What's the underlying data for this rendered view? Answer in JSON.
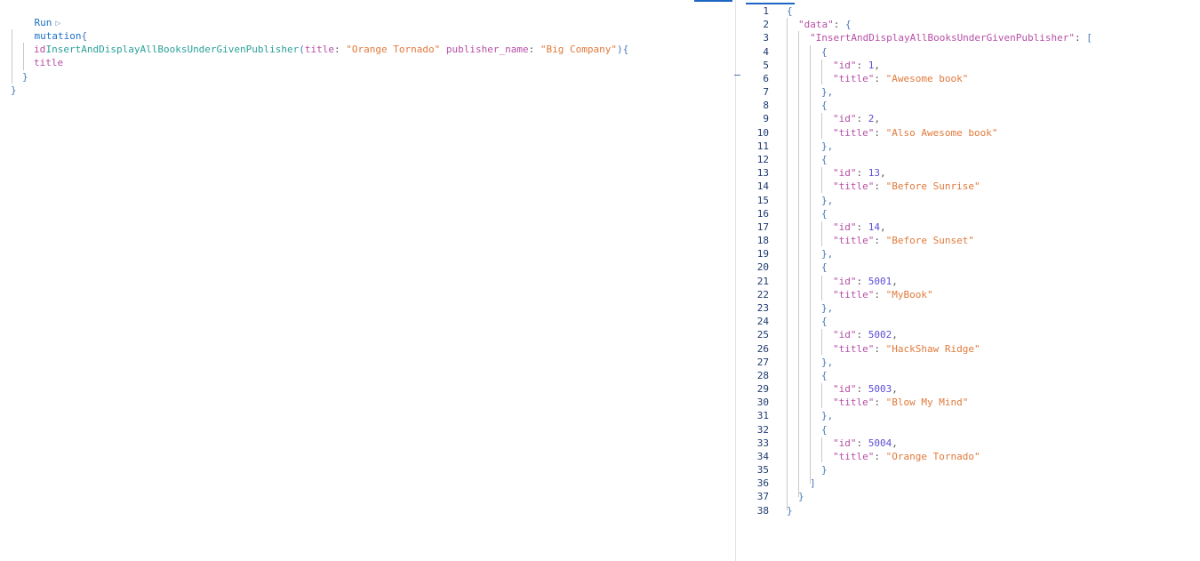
{
  "editor": {
    "run_label": "Run",
    "run_icon": "▷",
    "query": {
      "keyword": "mutation",
      "open_brace": "{",
      "field_name": "InsertAndDisplayAllBooksUnderGivenPublisher",
      "paren_open": "(",
      "arg1_name": "title",
      "arg_sep": ": ",
      "arg1_value": "\"Orange Tornado\"",
      "arg2_name": "publisher_name",
      "arg2_value": "\"Big Company\"",
      "paren_close": ")",
      "selection_open": "{",
      "selections": [
        "id",
        "title"
      ],
      "selection_close": "}",
      "close_brace": "}"
    }
  },
  "result": {
    "line_numbers": [
      "1",
      "2",
      "3",
      "4",
      "5",
      "6",
      "7",
      "8",
      "9",
      "10",
      "11",
      "12",
      "13",
      "14",
      "15",
      "16",
      "17",
      "18",
      "19",
      "20",
      "21",
      "22",
      "23",
      "24",
      "25",
      "26",
      "27",
      "28",
      "29",
      "30",
      "31",
      "32",
      "33",
      "34",
      "35",
      "36",
      "37",
      "38"
    ],
    "data_key": "\"data\"",
    "field_key": "\"InsertAndDisplayAllBooksUnderGivenPublisher\"",
    "id_key": "\"id\"",
    "title_key": "\"title\"",
    "books": [
      {
        "id": "1",
        "title": "\"Awesome book\""
      },
      {
        "id": "2",
        "title": "\"Also Awesome book\""
      },
      {
        "id": "13",
        "title": "\"Before Sunrise\""
      },
      {
        "id": "14",
        "title": "\"Before Sunset\""
      },
      {
        "id": "5001",
        "title": "\"MyBook\""
      },
      {
        "id": "5002",
        "title": "\"HackShaw Ridge\""
      },
      {
        "id": "5003",
        "title": "\"Blow My Mind\""
      },
      {
        "id": "5004",
        "title": "\"Orange Tornado\""
      }
    ]
  }
}
